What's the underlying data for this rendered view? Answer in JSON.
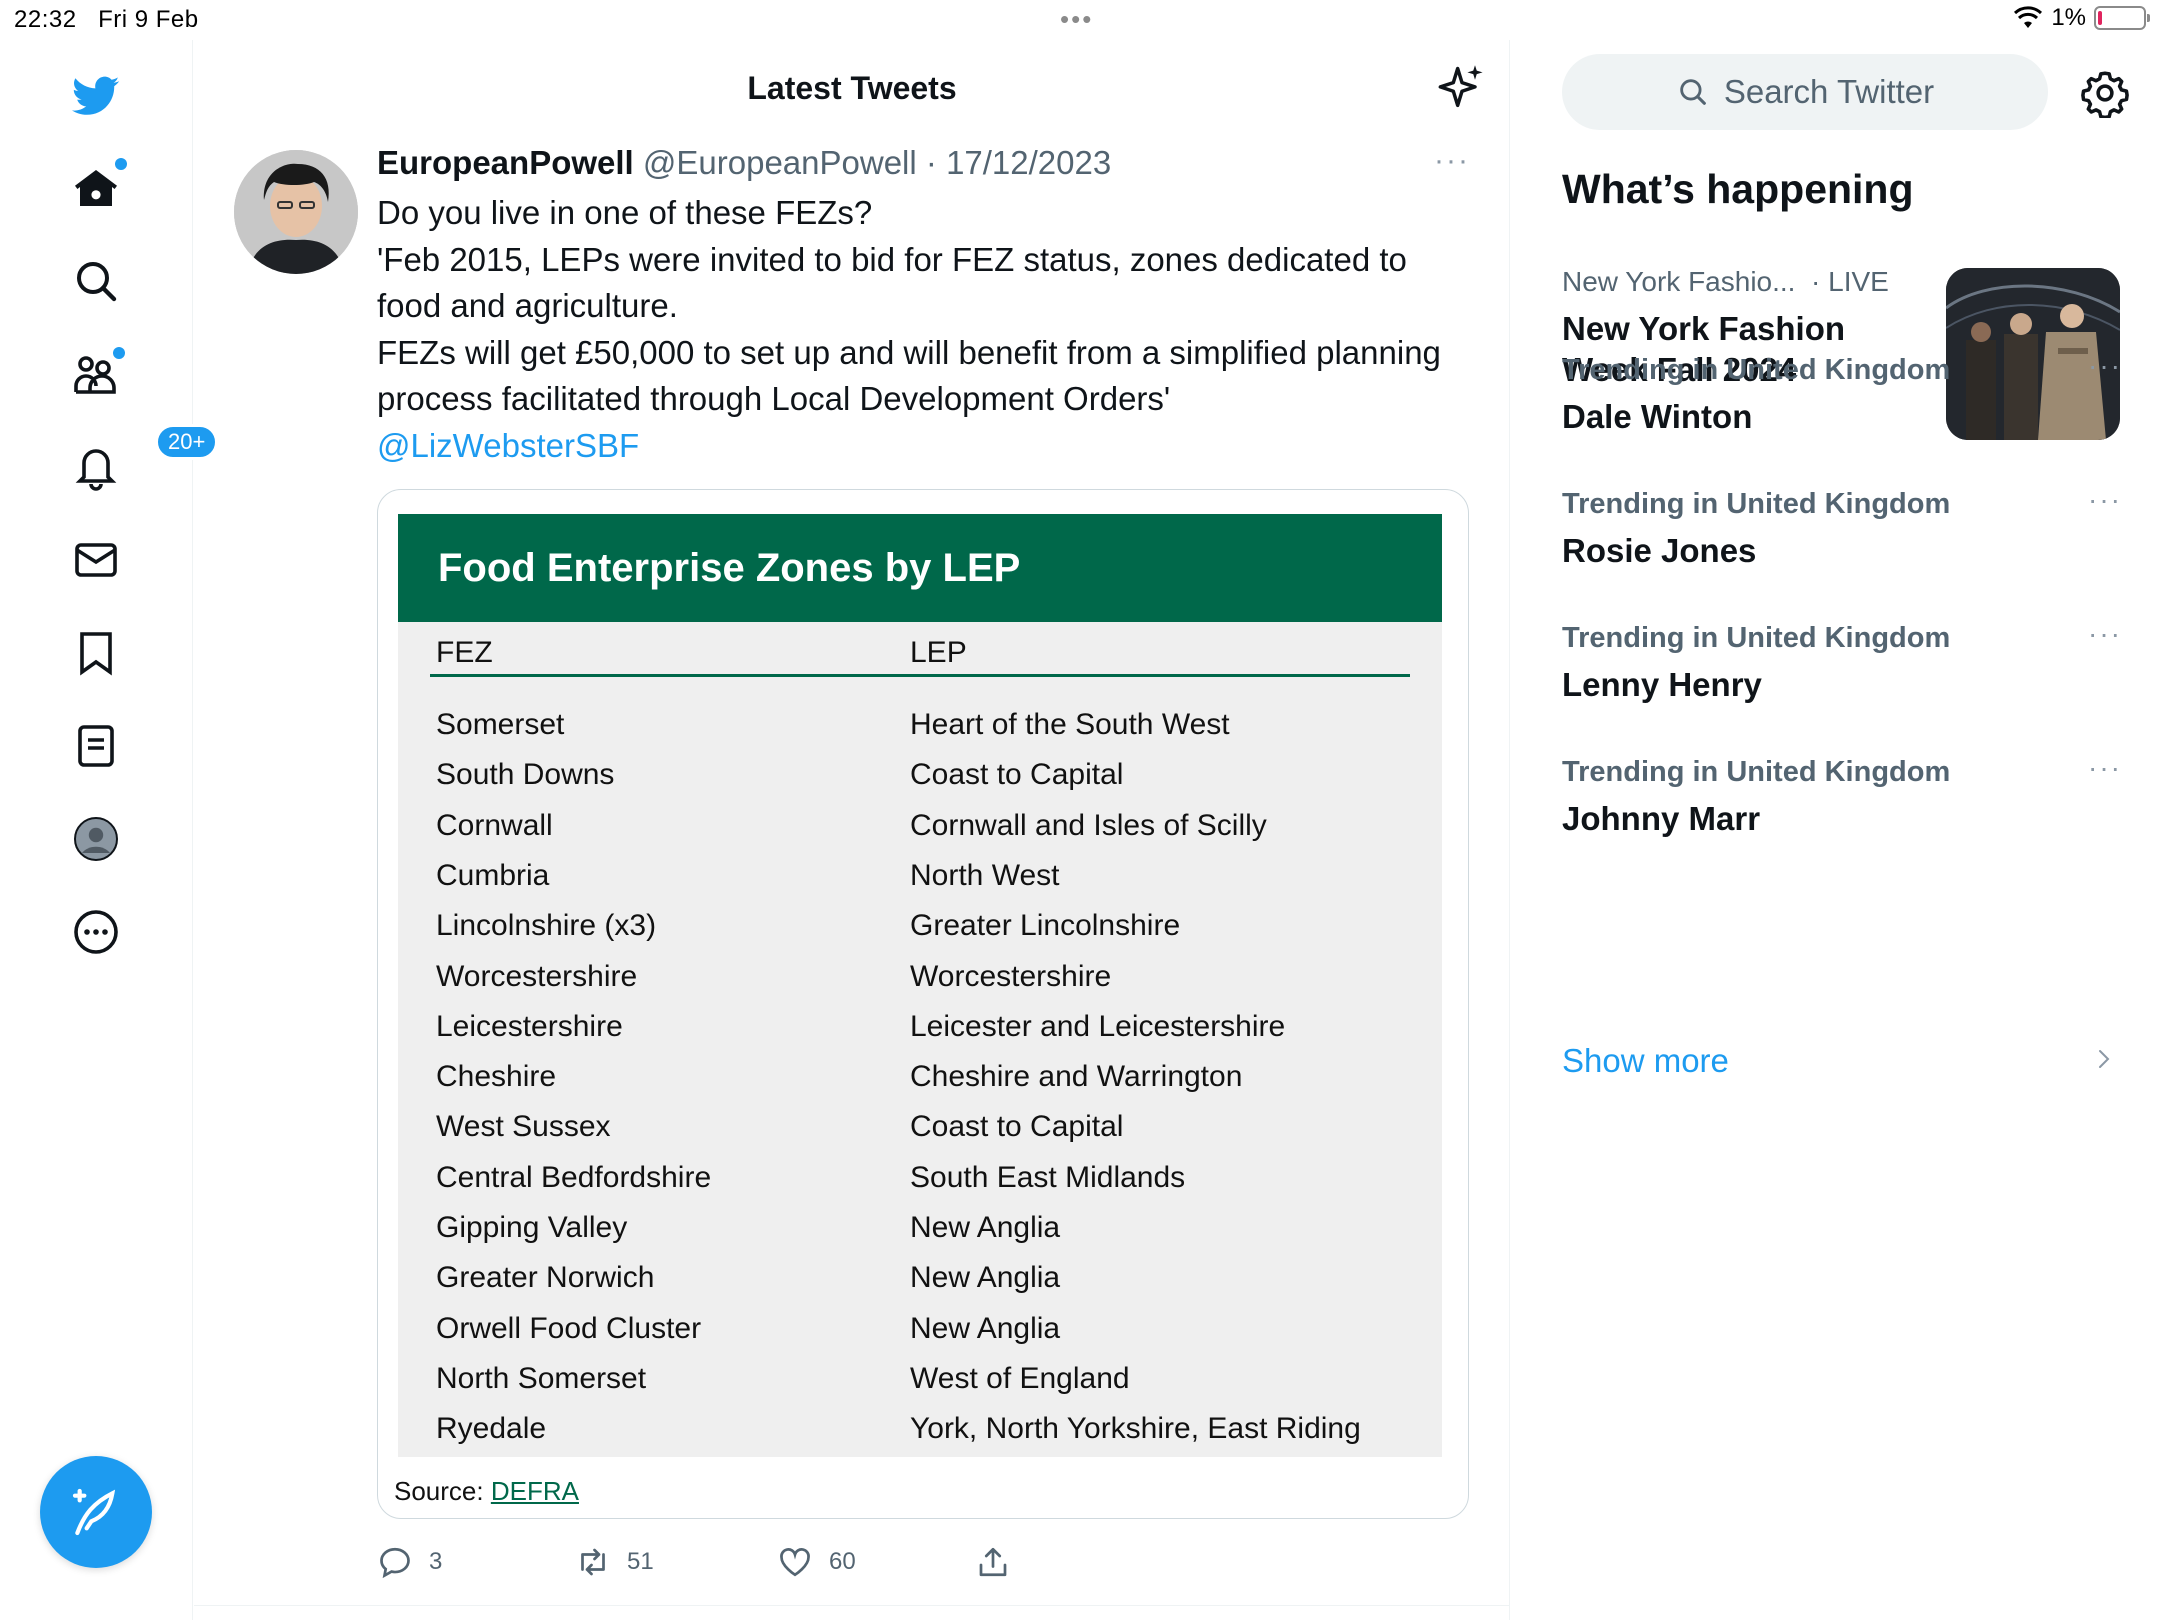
{
  "status_bar": {
    "time": "22:32",
    "date": "Fri 9 Feb",
    "battery": "1%"
  },
  "nav": {
    "notifications_badge": "20+",
    "items": [
      "twitter-logo-icon",
      "home-icon",
      "search-icon",
      "communities-icon",
      "notifications-icon",
      "messages-icon",
      "bookmarks-icon",
      "lists-icon",
      "profile-icon",
      "more-icon"
    ]
  },
  "header": {
    "title": "Latest Tweets"
  },
  "tweet": {
    "name": "EuropeanPowell",
    "handle": "@EuropeanPowell",
    "separator": " · ",
    "date": "17/12/2023",
    "more": "···",
    "lines": [
      "Do you live in one of these FEZs?",
      "'Feb 2015, LEPs were invited to bid for FEZ status, zones dedicated to food and agriculture.",
      "FEZs will get £50,000 to set up and will benefit from a simplified planning process facilitated through Local Development Orders'"
    ],
    "mention": "@LizWebsterSBF",
    "image": {
      "title": "Food Enterprise Zones by LEP",
      "col_fez": "FEZ",
      "col_lep": "LEP",
      "rows": [
        [
          "Somerset",
          "Heart of the South West"
        ],
        [
          "South Downs",
          "Coast to Capital"
        ],
        [
          "Cornwall",
          "Cornwall and Isles of Scilly"
        ],
        [
          "Cumbria",
          "North West"
        ],
        [
          "Lincolnshire (x3)",
          "Greater Lincolnshire"
        ],
        [
          "Worcestershire",
          "Worcestershire"
        ],
        [
          "Leicestershire",
          "Leicester and Leicestershire"
        ],
        [
          "Cheshire",
          "Cheshire and Warrington"
        ],
        [
          "West Sussex",
          "Coast to Capital"
        ],
        [
          "Central Bedfordshire",
          "South East Midlands"
        ],
        [
          "Gipping Valley",
          "New Anglia"
        ],
        [
          "Greater Norwich",
          "New Anglia"
        ],
        [
          "Orwell Food Cluster",
          "New Anglia"
        ],
        [
          "North Somerset",
          "West of England"
        ],
        [
          "Ryedale",
          "York, North Yorkshire, East Riding"
        ]
      ],
      "source_label": "Source:",
      "source_link": "DEFRA",
      "accent_color": "#00684a"
    },
    "replies": "3",
    "retweets": "51",
    "likes": "60"
  },
  "sidebar": {
    "search_placeholder": "Search Twitter",
    "section_title": "What’s happening",
    "top_trend": {
      "category": "New York Fashio...",
      "live": "· LIVE",
      "title": "New York Fashion Week Fall 2024"
    },
    "trends": [
      {
        "meta": "Trending in United Kingdom",
        "title": "Dale Winton"
      },
      {
        "meta": "Trending in United Kingdom",
        "title": "Rosie Jones"
      },
      {
        "meta": "Trending in United Kingdom",
        "title": "Lenny Henry"
      },
      {
        "meta": "Trending in United Kingdom",
        "title": "Johnny Marr"
      }
    ],
    "trend_more": "···",
    "show_more": "Show more"
  },
  "colors": {
    "brand": "#1d9bf0",
    "text": "#0f1419",
    "muted": "#536471"
  }
}
